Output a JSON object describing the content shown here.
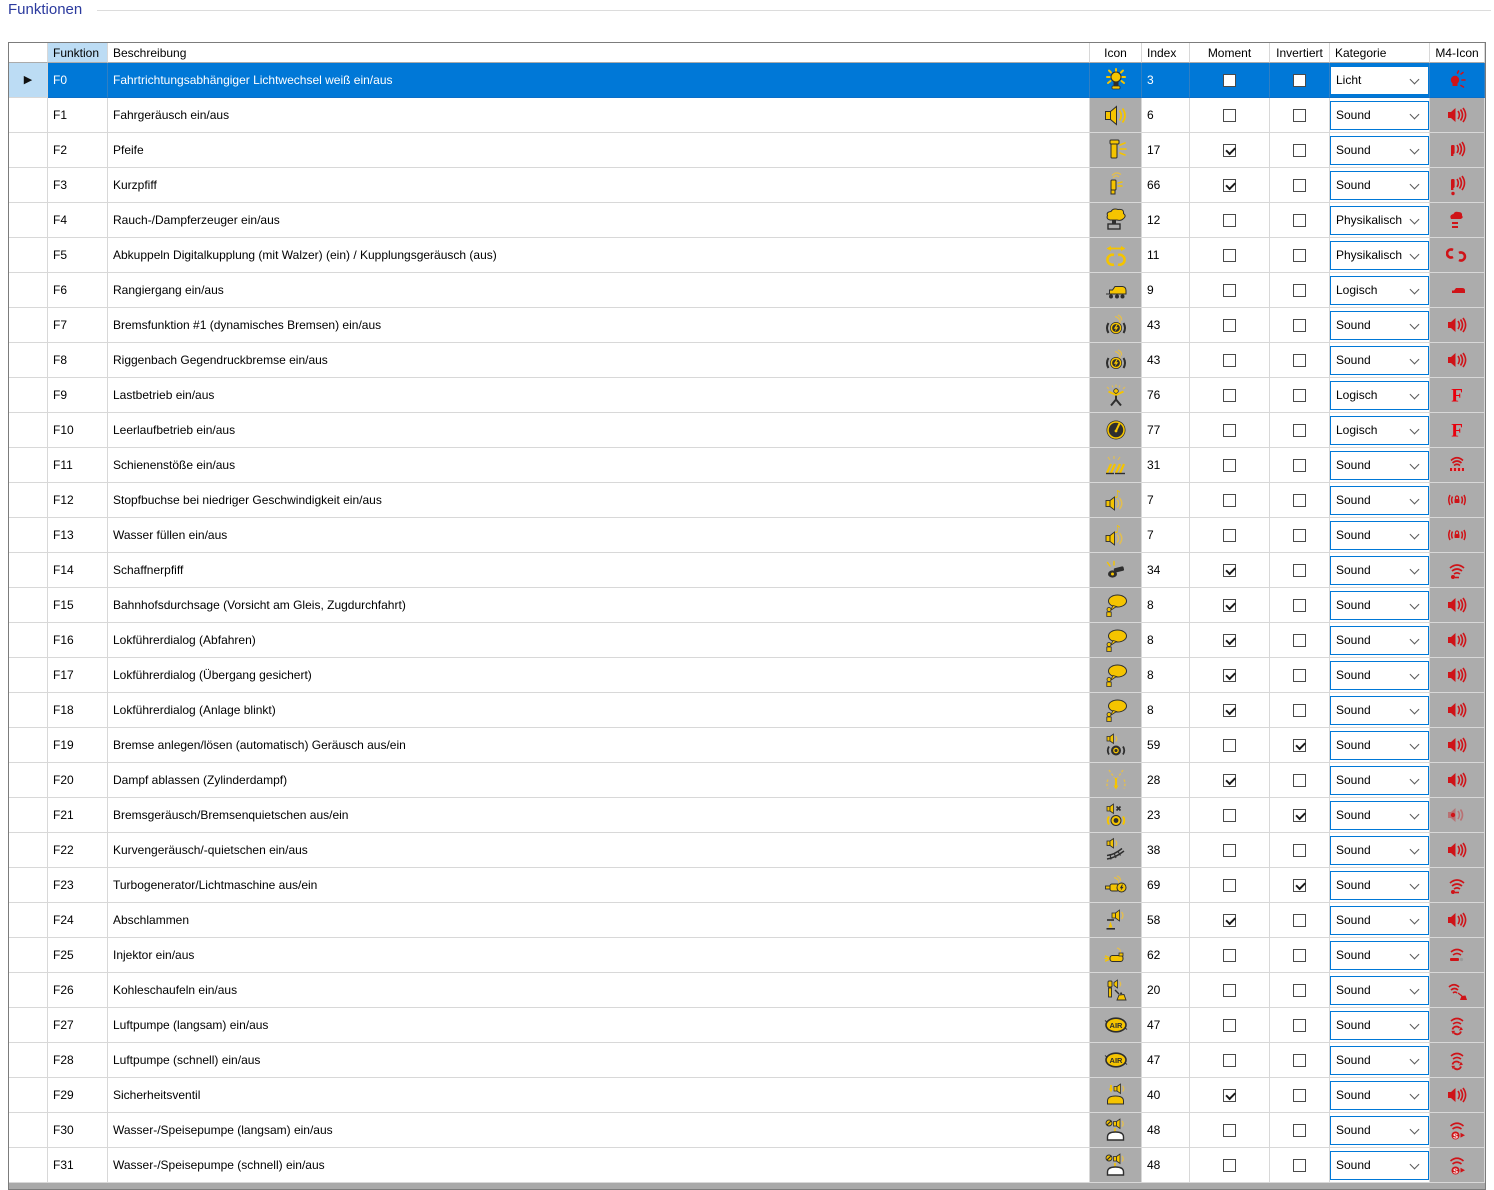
{
  "title": "Funktionen",
  "colors": {
    "selection_blue": "#0078D7",
    "header_highlight_blue": "#BCDCF4",
    "icon_cell_gray": "#ACACAC",
    "icon_yellow": "#F5C400",
    "m4_red": "#CF1318",
    "title_blue": "#2B3A9E"
  },
  "table": {
    "headers": {
      "funktion": "Funktion",
      "beschreibung": "Beschreibung",
      "icon": "Icon",
      "index": "Index",
      "moment": "Moment",
      "invertiert": "Invertiert",
      "kategorie": "Kategorie",
      "m4": "M4-Icon"
    },
    "rows": [
      {
        "funktion": "F0",
        "beschreibung": "Fahrtrichtungsabhängiger Lichtwechsel weiß ein/aus",
        "icon": "light",
        "index": "3",
        "moment": false,
        "invertiert": false,
        "kategorie": "Licht",
        "m4": "bulb",
        "selected": true
      },
      {
        "funktion": "F1",
        "beschreibung": "Fahrgeräusch ein/aus",
        "icon": "speaker",
        "index": "6",
        "moment": false,
        "invertiert": false,
        "kategorie": "Sound",
        "m4": "speaker",
        "selected": false
      },
      {
        "funktion": "F2",
        "beschreibung": "Pfeife",
        "icon": "whistle",
        "index": "17",
        "moment": true,
        "invertiert": false,
        "kategorie": "Sound",
        "m4": "whistlew",
        "selected": false
      },
      {
        "funktion": "F3",
        "beschreibung": "Kurzpfiff",
        "icon": "whistle2",
        "index": "66",
        "moment": true,
        "invertiert": false,
        "kategorie": "Sound",
        "m4": "whistledot",
        "selected": false
      },
      {
        "funktion": "F4",
        "beschreibung": "Rauch-/Dampferzeuger ein/aus",
        "icon": "smoke",
        "index": "12",
        "moment": false,
        "invertiert": false,
        "kategorie": "Physikalisch",
        "m4": "smoke",
        "selected": false
      },
      {
        "funktion": "F5",
        "beschreibung": "Abkuppeln Digitalkupplung (mit Walzer) (ein) / Kupplungsgeräusch (aus)",
        "icon": "coupler",
        "index": "11",
        "moment": false,
        "invertiert": false,
        "kategorie": "Physikalisch",
        "m4": "coupler",
        "selected": false
      },
      {
        "funktion": "F6",
        "beschreibung": "Rangiergang ein/aus",
        "icon": "loco",
        "index": "9",
        "moment": false,
        "invertiert": false,
        "kategorie": "Logisch",
        "m4": "loco",
        "selected": false
      },
      {
        "funktion": "F7",
        "beschreibung": "Bremsfunktion #1 (dynamisches Bremsen) ein/aus",
        "icon": "brake",
        "index": "43",
        "moment": false,
        "invertiert": false,
        "kategorie": "Sound",
        "m4": "speaker",
        "selected": false
      },
      {
        "funktion": "F8",
        "beschreibung": "Riggenbach Gegendruckbremse ein/aus",
        "icon": "brake",
        "index": "43",
        "moment": false,
        "invertiert": false,
        "kategorie": "Sound",
        "m4": "speaker",
        "selected": false
      },
      {
        "funktion": "F9",
        "beschreibung": "Lastbetrieb ein/aus",
        "icon": "figure",
        "index": "76",
        "moment": false,
        "invertiert": false,
        "kategorie": "Logisch",
        "m4": "fletter",
        "selected": false
      },
      {
        "funktion": "F10",
        "beschreibung": "Leerlaufbetrieb ein/aus",
        "icon": "gauge",
        "index": "77",
        "moment": false,
        "invertiert": false,
        "kategorie": "Logisch",
        "m4": "fletter",
        "selected": false
      },
      {
        "funktion": "F11",
        "beschreibung": "Schienenstöße ein/aus",
        "icon": "rails",
        "index": "31",
        "moment": false,
        "invertiert": false,
        "kategorie": "Sound",
        "m4": "railw",
        "selected": false
      },
      {
        "funktion": "F12",
        "beschreibung": "Stopfbuchse bei niedriger Geschwindigkeit ein/aus",
        "icon": "speakernote",
        "index": "7",
        "moment": false,
        "invertiert": false,
        "kategorie": "Sound",
        "m4": "lock",
        "selected": false
      },
      {
        "funktion": "F13",
        "beschreibung": "Wasser füllen ein/aus",
        "icon": "speakernote",
        "index": "7",
        "moment": false,
        "invertiert": false,
        "kategorie": "Sound",
        "m4": "lock",
        "selected": false
      },
      {
        "funktion": "F14",
        "beschreibung": "Schaffnerpfiff",
        "icon": "conductor",
        "index": "34",
        "moment": true,
        "invertiert": false,
        "kategorie": "Sound",
        "m4": "wavesdot",
        "selected": false
      },
      {
        "funktion": "F15",
        "beschreibung": "Bahnhofsdurchsage (Vorsicht am Gleis, Zugdurchfahrt)",
        "icon": "balloon",
        "index": "8",
        "moment": true,
        "invertiert": false,
        "kategorie": "Sound",
        "m4": "speaker",
        "selected": false
      },
      {
        "funktion": "F16",
        "beschreibung": "Lokführerdialog (Abfahren)",
        "icon": "balloon",
        "index": "8",
        "moment": true,
        "invertiert": false,
        "kategorie": "Sound",
        "m4": "speaker",
        "selected": false
      },
      {
        "funktion": "F17",
        "beschreibung": "Lokführerdialog (Übergang gesichert)",
        "icon": "balloon",
        "index": "8",
        "moment": true,
        "invertiert": false,
        "kategorie": "Sound",
        "m4": "speaker",
        "selected": false
      },
      {
        "funktion": "F18",
        "beschreibung": "Lokführerdialog (Anlage blinkt)",
        "icon": "balloon",
        "index": "8",
        "moment": true,
        "invertiert": false,
        "kategorie": "Sound",
        "m4": "speaker",
        "selected": false
      },
      {
        "funktion": "F19",
        "beschreibung": "Bremse anlegen/lösen (automatisch) Geräusch aus/ein",
        "icon": "spkbrake",
        "index": "59",
        "moment": false,
        "invertiert": true,
        "kategorie": "Sound",
        "m4": "speaker",
        "selected": false
      },
      {
        "funktion": "F20",
        "beschreibung": "Dampf ablassen (Zylinderdampf)",
        "icon": "steamv",
        "index": "28",
        "moment": true,
        "invertiert": false,
        "kategorie": "Sound",
        "m4": "speaker",
        "selected": false
      },
      {
        "funktion": "F21",
        "beschreibung": "Bremsgeräusch/Bremsenquietschen aus/ein",
        "icon": "spkmute",
        "index": "23",
        "moment": false,
        "invertiert": true,
        "kategorie": "Sound",
        "m4": "spkdim",
        "selected": false
      },
      {
        "funktion": "F22",
        "beschreibung": "Kurvengeräusch/-quietschen ein/aus",
        "icon": "spkrails",
        "index": "38",
        "moment": false,
        "invertiert": false,
        "kategorie": "Sound",
        "m4": "speaker",
        "selected": false
      },
      {
        "funktion": "F23",
        "beschreibung": "Turbogenerator/Lichtmaschine aus/ein",
        "icon": "generator",
        "index": "69",
        "moment": false,
        "invertiert": true,
        "kategorie": "Sound",
        "m4": "wavesdot",
        "selected": false
      },
      {
        "funktion": "F24",
        "beschreibung": "Abschlammen",
        "icon": "spkpole",
        "index": "58",
        "moment": true,
        "invertiert": false,
        "kategorie": "Sound",
        "m4": "speaker",
        "selected": false
      },
      {
        "funktion": "F25",
        "beschreibung": "Injektor ein/aus",
        "icon": "injector",
        "index": "62",
        "moment": false,
        "invertiert": false,
        "kategorie": "Sound",
        "m4": "wavesbar",
        "selected": false
      },
      {
        "funktion": "F26",
        "beschreibung": "Kohleschaufeln ein/aus",
        "icon": "shovel",
        "index": "20",
        "moment": false,
        "invertiert": false,
        "kategorie": "Sound",
        "m4": "wavesshovel",
        "selected": false
      },
      {
        "funktion": "F27",
        "beschreibung": "Luftpumpe (langsam) ein/aus",
        "icon": "air",
        "index": "47",
        "moment": false,
        "invertiert": false,
        "kategorie": "Sound",
        "m4": "wavespump",
        "selected": false
      },
      {
        "funktion": "F28",
        "beschreibung": "Luftpumpe (schnell) ein/aus",
        "icon": "air",
        "index": "47",
        "moment": false,
        "invertiert": false,
        "kategorie": "Sound",
        "m4": "wavespump",
        "selected": false
      },
      {
        "funktion": "F29",
        "beschreibung": "Sicherheitsventil",
        "icon": "valve",
        "index": "40",
        "moment": true,
        "invertiert": false,
        "kategorie": "Sound",
        "m4": "speaker",
        "selected": false
      },
      {
        "funktion": "F30",
        "beschreibung": "Wasser-/Speisepumpe (langsam) ein/aus",
        "icon": "pump",
        "index": "48",
        "moment": false,
        "invertiert": false,
        "kategorie": "Sound",
        "m4": "wavespump2",
        "selected": false
      },
      {
        "funktion": "F31",
        "beschreibung": "Wasser-/Speisepumpe (schnell) ein/aus",
        "icon": "pump",
        "index": "48",
        "moment": false,
        "invertiert": false,
        "kategorie": "Sound",
        "m4": "wavespump2",
        "selected": false
      }
    ]
  }
}
